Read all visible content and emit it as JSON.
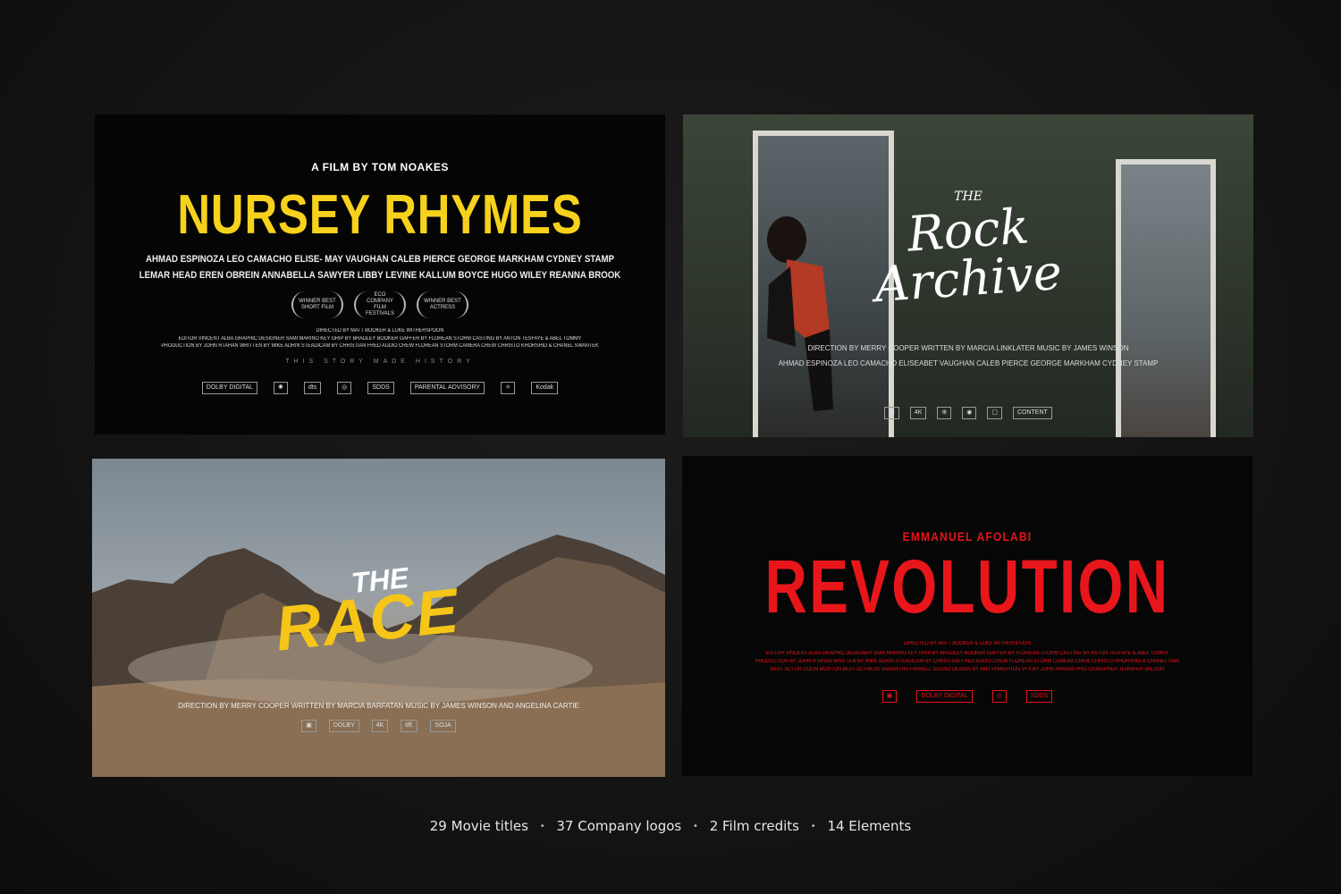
{
  "cards": {
    "nursey": {
      "byline": "A FILM BY TOM NOAKES",
      "title": "NURSEY RHYMES",
      "cast_line1": "AHMAD ESPINOZA   LEO CAMACHO   ELISE- MAY VAUGHAN   CALEB PIERCE   GEORGE MARKHAM   CYDNEY STAMP",
      "cast_line2": "LEMAR HEAD   EREN OBREIN   ANNABELLA SAWYER   LIBBY LEVINE   KALLUM BOYCE   HUGO WILEY   REANNA BROOK",
      "laurels": [
        "WINNER BEST SHORT FILM",
        "ECO COMPANY FILM FESTIVALS",
        "WINNER BEST ACTRESS"
      ],
      "credits_line1": "DIRECTED BY MATT BOOKER & LUKE WITHERSPOON",
      "credits_line2": "EDITOR VINCENT ALBA  GRAPHIC DESIGNER SAMI MARINO  KEY GRIP BY BRADLEY BOOKER  GAFFER BY FLOREAN STORM  CASTING BY ANTON TESFAYE & ABEL TOMMY",
      "credits_line3": "PRODUCTION BY JOHN RTAHAN  WRITTEN BY MIKE ADRIN  STEADICAM BY CHRISTIAN FRED  AUDIO CREW FLOREAN STORM  CAMERA CREW CHRISTO KHORSHID & CHANEL SWANTEK",
      "tagline": "THIS STORY MADE HISTORY",
      "logos": [
        "DOLBY DIGITAL",
        "✺",
        "dts",
        "◎",
        "SDDS",
        "PARENTAL ADVISORY",
        "⚛",
        "Kodak"
      ]
    },
    "rock": {
      "the": "THE",
      "title_line1": "Rock",
      "title_line2": "Archive",
      "credits": "DIRECTION BY MERRY COOPER  WRITTEN BY MARCIA LINKLATER  MUSIC BY JAMES WINSON",
      "cast": "AHMAD ESPINOZA    LEO CAMACHO    ELISEABET VAUGHAN    CALEB PIERCE    GEORGE MARKHAM    CYDNEY STAMP",
      "logos": [
        "▣",
        "4K",
        "⊕",
        "◉",
        "▢",
        "CONTENT"
      ]
    },
    "race": {
      "the": "THE",
      "title": "RACE",
      "credits": "DIRECTION BY MERRY COOPER   WRITTEN BY MARCIA BARFATAN   MUSIC BY JAMES WINSON  AND  ANGELINA CARTIE",
      "logos": [
        "▣",
        "DOLBY",
        "4K",
        "tiff.",
        "SOJA"
      ]
    },
    "revolution": {
      "name": "EMMANUEL AFOLABI",
      "title": "REVOLUTION",
      "credits_line1": "DIRECTED BY MATT BOOKER & LUKE WITHERSPOON",
      "credits_line2": "EDITOR VINCENT ALBA  GRAPHIC DESIGNER SAMI MARINO  KEY GRIP BY BRADLEY BOOKER  GAFFER BY FLOREAN STORM  CASTING BY ANTON TESFAYE & ABEL TOMMY",
      "credits_line3": "PRODUCTION BY JOHN RTAHAN  WRITTEN BY MIKE ADRIN  STEADICAM BY CHRISTIAN FRED  AUDIO CREW FLOREAN STORM  CAMERA CREW CHRISTO KHORSHID & CHANEL SWA",
      "credits_line4": "BEST ACTOR COLIN MORTON  BEST ACTRESS SAMANTHA FARRELL  SOUND DESIGN BY MIKI PINKERTON  VFX BY JOHN HAMANI  PHOTOGRAPHER JENNIFER WILSON",
      "logos": [
        "▣",
        "DOLBY DIGITAL",
        "◎",
        "SDDS"
      ]
    }
  },
  "footer": {
    "item1": "29 Movie titles",
    "item2": "37 Company logos",
    "item3": "2 Film credits",
    "item4": "14 Elements",
    "separator": "•"
  },
  "colors": {
    "yellow": "#f7d21c",
    "red": "#e8161b",
    "race_yellow": "#f5c518",
    "background": "#141414"
  }
}
